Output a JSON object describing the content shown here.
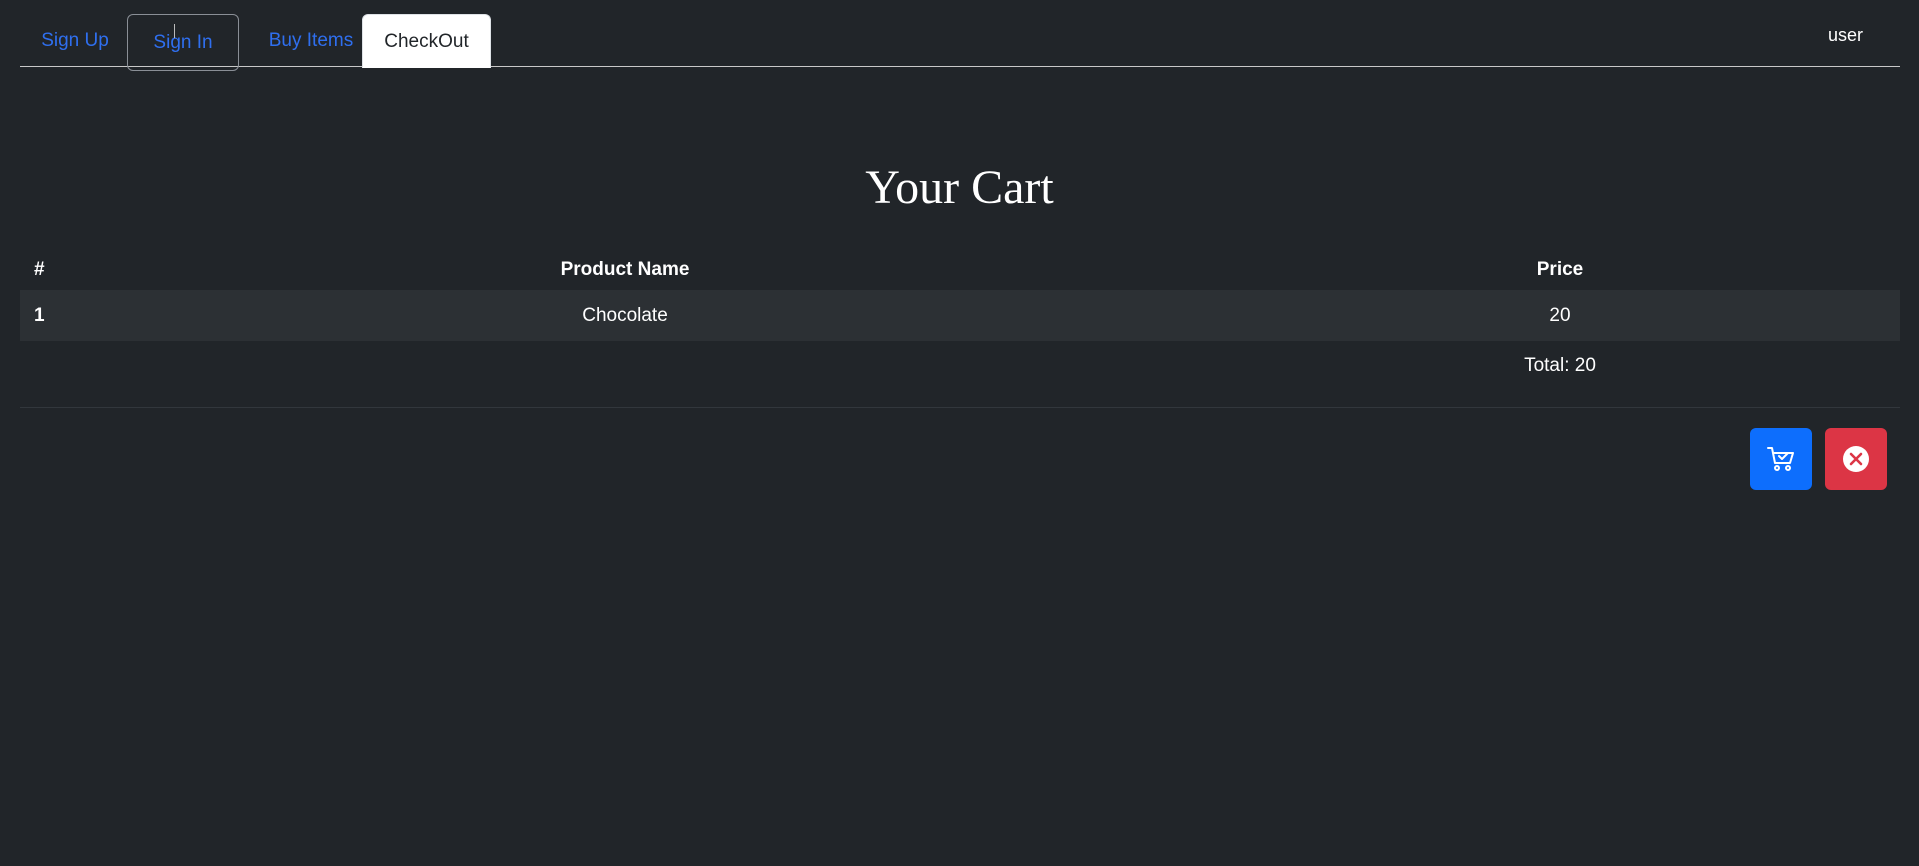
{
  "nav": {
    "tabs": [
      {
        "label": "Sign Up"
      },
      {
        "label": "Sign In"
      },
      {
        "label": "Buy Items"
      },
      {
        "label": "CheckOut"
      }
    ],
    "user_label": "user"
  },
  "main": {
    "title": "Your Cart",
    "table": {
      "headers": {
        "num": "#",
        "name": "Product Name",
        "price": "Price"
      },
      "rows": [
        {
          "num": "1",
          "name": "Chocolate",
          "price": "20"
        }
      ],
      "total": "Total: 20"
    }
  },
  "actions": {
    "checkout_icon": "cart-check-icon",
    "cancel_icon": "x-circle-icon"
  },
  "colors": {
    "background": "#212529",
    "link": "#2f6fef",
    "primary": "#0d6efd",
    "danger": "#dc3545"
  }
}
